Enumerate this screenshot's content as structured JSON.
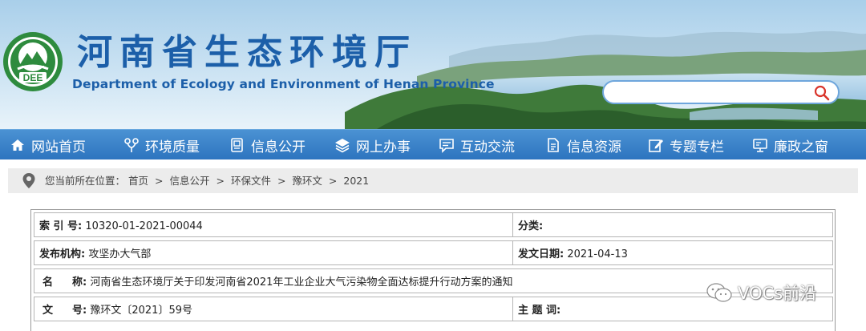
{
  "header": {
    "title": "河南省生态环境厅",
    "subtitle": "Department of Ecology and Environment of Henan Province",
    "logo_text": "DEE",
    "search": {
      "placeholder": "",
      "icon": "search-icon"
    }
  },
  "colors": {
    "brand_blue": "#1c5fa9",
    "nav_blue": "#3a82c9",
    "crumb_bg": "#ececec",
    "search_red": "#d9342b"
  },
  "nav": {
    "items": [
      {
        "label": "网站首页",
        "icon": "home-icon"
      },
      {
        "label": "环境质量",
        "icon": "environment-quality-icon"
      },
      {
        "label": "信息公开",
        "icon": "document-stack-icon"
      },
      {
        "label": "网上办事",
        "icon": "layers-icon"
      },
      {
        "label": "互动交流",
        "icon": "chat-bubble-icon"
      },
      {
        "label": "信息资源",
        "icon": "file-text-icon"
      },
      {
        "label": "专题专栏",
        "icon": "edit-icon"
      },
      {
        "label": "廉政之窗",
        "icon": "monitor-icon"
      }
    ]
  },
  "breadcrumb": {
    "prefix": "您当前所在位置：",
    "items": [
      "首页",
      "信息公开",
      "环保文件",
      "豫环文",
      "2021"
    ],
    "separator": ">"
  },
  "info": {
    "index_label": "索 引 号:",
    "index_value": "10320-01-2021-00044",
    "category_label": "分类:",
    "category_value": "",
    "publisher_label": "发布机构:",
    "publisher_value": "攻坚办大气部",
    "date_label": "发文日期:",
    "date_value": "2021-04-13",
    "name_label_a": "名",
    "name_label_b": "称:",
    "name_value": "河南省生态环境厅关于印发河南省2021年工业企业大气污染物全面达标提升行动方案的通知",
    "docno_label_a": "文",
    "docno_label_b": "号:",
    "docno_value": "豫环文〔2021〕59号",
    "subject_label": "主 题 词:",
    "subject_value": ""
  },
  "watermark": {
    "text": "VOCs前沿"
  }
}
